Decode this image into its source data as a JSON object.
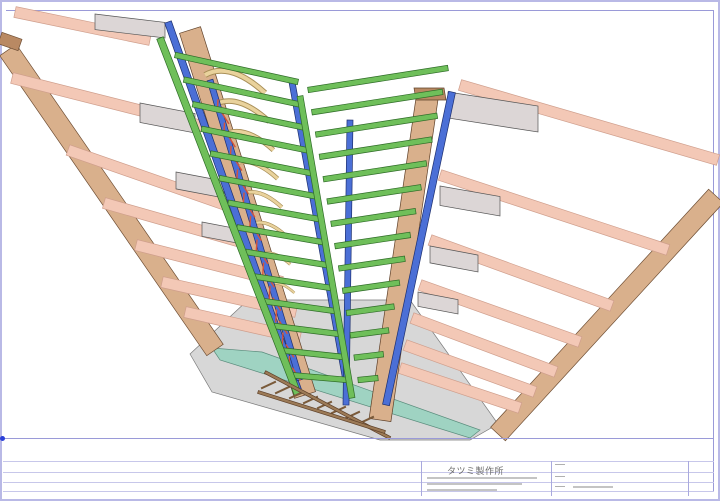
{
  "title_block": {
    "company": "タツミ製作所"
  },
  "colors": {
    "sheet_border": "#b9b9e6",
    "timber": "#d9b08c",
    "timber_dark": "#b98963",
    "pink_beam": "#f3c8b6",
    "pink_beam_edge": "#cf9e8c",
    "grey_block": "#dcd6d6",
    "green_frame": "#6fbf5a",
    "green_frame_edge": "#2e6b27",
    "blue_post": "#4b6fd6",
    "red_brace": "#d6543a",
    "tan_arc": "#e9d29c",
    "floor": "#d7d7d7",
    "teal_plate": "#9fd3c2"
  }
}
